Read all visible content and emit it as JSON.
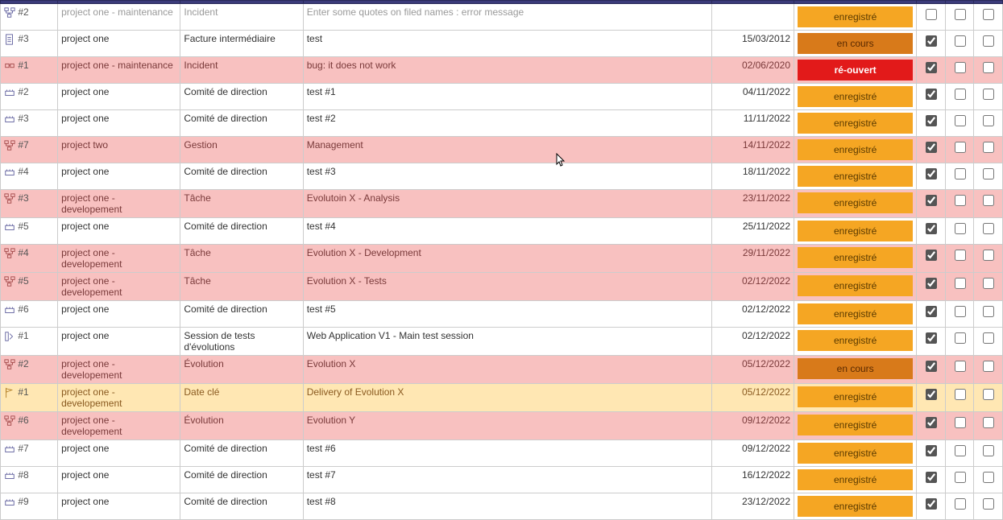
{
  "status_labels": {
    "enregistre": "enregistré",
    "en_cours": "en cours",
    "re_ouvert": "ré-ouvert"
  },
  "rows": [
    {
      "id": "#2",
      "icon": "tree",
      "project": "project one - maintenance",
      "type": "Incident",
      "name": "Enter some quotes on filed names : error message",
      "date": "",
      "status": "enregistre",
      "status_style": "st-orange",
      "row_class": "trunc-row",
      "cb": [
        false,
        false,
        false
      ]
    },
    {
      "id": "#3",
      "icon": "doc",
      "project": "project one",
      "type": "Facture intermédiaire",
      "name": "test",
      "date": "15/03/2012",
      "status": "en_cours",
      "status_style": "st-dark",
      "row_class": "row-white",
      "cb": [
        true,
        false,
        false
      ]
    },
    {
      "id": "#1",
      "icon": "bug",
      "project": "project one - maintenance",
      "type": "Incident",
      "name": "bug: it does not work",
      "date": "02/06/2020",
      "status": "re_ouvert",
      "status_style": "st-red",
      "row_class": "row-pink",
      "cb": [
        true,
        false,
        false
      ]
    },
    {
      "id": "#2",
      "icon": "meet",
      "project": "project one",
      "type": "Comité de direction",
      "name": "test #1",
      "date": "04/11/2022",
      "status": "enregistre",
      "status_style": "st-orange",
      "row_class": "row-white",
      "cb": [
        true,
        false,
        false
      ]
    },
    {
      "id": "#3",
      "icon": "meet",
      "project": "project one",
      "type": "Comité de direction",
      "name": "test #2",
      "date": "11/11/2022",
      "status": "enregistre",
      "status_style": "st-orange",
      "row_class": "row-white",
      "cb": [
        true,
        false,
        false
      ]
    },
    {
      "id": "#7",
      "icon": "tree",
      "project": "project two",
      "type": "Gestion",
      "name": "Management",
      "date": "14/11/2022",
      "status": "enregistre",
      "status_style": "st-orange",
      "row_class": "row-pink",
      "cb": [
        true,
        false,
        false
      ]
    },
    {
      "id": "#4",
      "icon": "meet",
      "project": "project one",
      "type": "Comité de direction",
      "name": "test #3",
      "date": "18/11/2022",
      "status": "enregistre",
      "status_style": "st-orange",
      "row_class": "row-white",
      "cb": [
        true,
        false,
        false
      ]
    },
    {
      "id": "#3",
      "icon": "tree",
      "project": "project one - developement",
      "type": "Tâche",
      "name": "Evolutoin X - Analysis",
      "date": "23/11/2022",
      "status": "enregistre",
      "status_style": "st-orange",
      "row_class": "row-pink",
      "cb": [
        true,
        false,
        false
      ]
    },
    {
      "id": "#5",
      "icon": "meet",
      "project": "project one",
      "type": "Comité de direction",
      "name": "test #4",
      "date": "25/11/2022",
      "status": "enregistre",
      "status_style": "st-orange",
      "row_class": "row-white",
      "cb": [
        true,
        false,
        false
      ]
    },
    {
      "id": "#4",
      "icon": "tree",
      "project": "project one - developement",
      "type": "Tâche",
      "name": "Evolution X - Development",
      "date": "29/11/2022",
      "status": "enregistre",
      "status_style": "st-orange",
      "row_class": "row-pink",
      "cb": [
        true,
        false,
        false
      ]
    },
    {
      "id": "#5",
      "icon": "tree",
      "project": "project one - developement",
      "type": "Tâche",
      "name": "Evolution X - Tests",
      "date": "02/12/2022",
      "status": "enregistre",
      "status_style": "st-orange",
      "row_class": "row-pink",
      "cb": [
        true,
        false,
        false
      ]
    },
    {
      "id": "#6",
      "icon": "meet",
      "project": "project one",
      "type": "Comité de direction",
      "name": "test #5",
      "date": "02/12/2022",
      "status": "enregistre",
      "status_style": "st-orange",
      "row_class": "row-white",
      "cb": [
        true,
        false,
        false
      ]
    },
    {
      "id": "#1",
      "icon": "test",
      "project": "project one",
      "type": "Session de tests d'évolutions",
      "name": "Web Application V1 - Main test session",
      "date": "02/12/2022",
      "status": "enregistre",
      "status_style": "st-orange",
      "row_class": "row-white",
      "cb": [
        true,
        false,
        false
      ]
    },
    {
      "id": "#2",
      "icon": "tree",
      "project": "project one - developement",
      "type": "Évolution",
      "name": "Evolution X",
      "date": "05/12/2022",
      "status": "en_cours",
      "status_style": "st-dark",
      "row_class": "row-pink",
      "cb": [
        true,
        false,
        false
      ]
    },
    {
      "id": "#1",
      "icon": "flag",
      "project": "project one - developement",
      "type": "Date clé",
      "name": "Delivery of Evolution X",
      "date": "05/12/2022",
      "status": "enregistre",
      "status_style": "st-orange",
      "row_class": "row-cream",
      "cb": [
        true,
        false,
        false
      ]
    },
    {
      "id": "#6",
      "icon": "tree",
      "project": "project one - developement",
      "type": "Évolution",
      "name": "Evolution Y",
      "date": "09/12/2022",
      "status": "enregistre",
      "status_style": "st-orange",
      "row_class": "row-pink",
      "cb": [
        true,
        false,
        false
      ]
    },
    {
      "id": "#7",
      "icon": "meet",
      "project": "project one",
      "type": "Comité de direction",
      "name": "test #6",
      "date": "09/12/2022",
      "status": "enregistre",
      "status_style": "st-orange",
      "row_class": "row-white",
      "cb": [
        true,
        false,
        false
      ]
    },
    {
      "id": "#8",
      "icon": "meet",
      "project": "project one",
      "type": "Comité de direction",
      "name": "test #7",
      "date": "16/12/2022",
      "status": "enregistre",
      "status_style": "st-orange",
      "row_class": "row-white",
      "cb": [
        true,
        false,
        false
      ]
    },
    {
      "id": "#9",
      "icon": "meet",
      "project": "project one",
      "type": "Comité de direction",
      "name": "test #8",
      "date": "23/12/2022",
      "status": "enregistre",
      "status_style": "st-orange",
      "row_class": "row-white",
      "cb": [
        true,
        false,
        false
      ]
    }
  ]
}
